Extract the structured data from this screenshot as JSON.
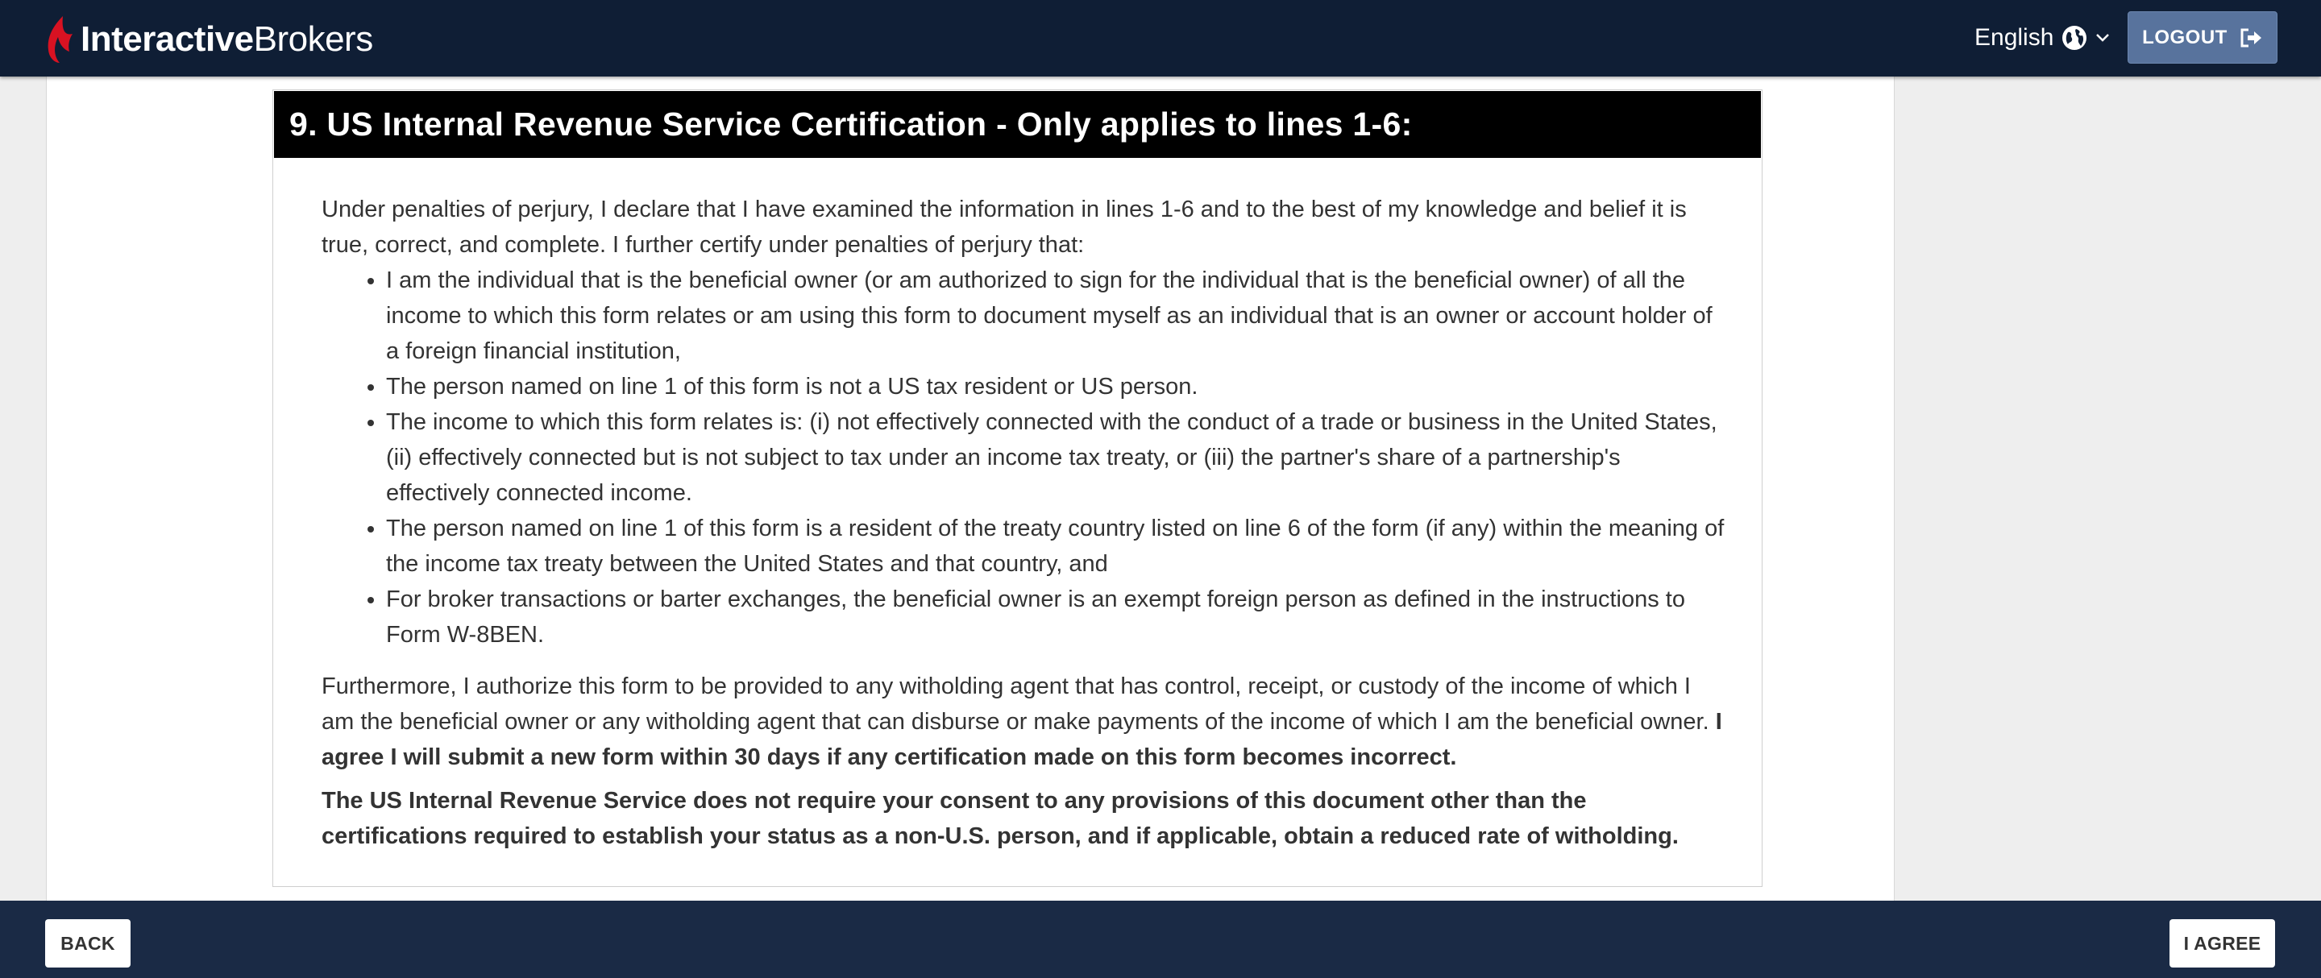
{
  "header": {
    "brand_bold": "Interactive",
    "brand_light": "Brokers",
    "language": "English",
    "logout_label": "LOGOUT"
  },
  "panel": {
    "title": "9. US Internal Revenue Service Certification - Only applies to lines 1-6:",
    "intro": "Under penalties of perjury, I declare that I have examined the information in lines 1-6 and to the best of my knowledge and belief it is true, correct, and complete. I further certify under penalties of perjury that:",
    "bullets": [
      "I am the individual that is the beneficial owner (or am authorized to sign for the individual that is the beneficial owner) of all the income to which this form relates or am using this form to document myself as an individual that is an owner or account holder of a foreign financial institution,",
      "The person named on line 1 of this form is not a US tax resident or US person.",
      "The income to which this form relates is: (i) not effectively connected with the conduct of a trade or business in the United States, (ii) effectively connected but is not subject to tax under an income tax treaty, or (iii) the partner's share of a partnership's effectively connected income.",
      "The person named on line 1 of this form is a resident of the treaty country listed on line 6 of the form (if any) within the meaning of the income tax treaty between the United States and that country, and",
      "For broker transactions or barter exchanges, the beneficial owner is an exempt foreign person as defined in the instructions to Form W-8BEN."
    ],
    "para2_normal": "Furthermore, I authorize this form to be provided to any witholding agent that has control, receipt, or custody of the income of which I am the beneficial owner or any witholding agent that can disburse or make payments of the income of which I am the beneficial owner.",
    "para2_bold": "I agree I will submit a new form within 30 days if any certification made on this form becomes incorrect.",
    "para3": "The US Internal Revenue Service does not require your consent to any provisions of this document other than the certifications required to establish your status as a non-U.S. person, and if applicable, obtain a reduced rate of witholding."
  },
  "footer": {
    "back_label": "BACK",
    "agree_label": "I AGREE"
  },
  "colors": {
    "nav_bg": "#0f1e35",
    "footer_bg": "#1a2a45",
    "logout_bg": "#58739d",
    "logo_red": "#d81222",
    "panel_head_bg": "#000000"
  },
  "icons": {
    "logo": "flame-logo-icon",
    "language": "globe-icon",
    "dropdown": "chevron-down-icon",
    "logout": "sign-out-icon"
  }
}
